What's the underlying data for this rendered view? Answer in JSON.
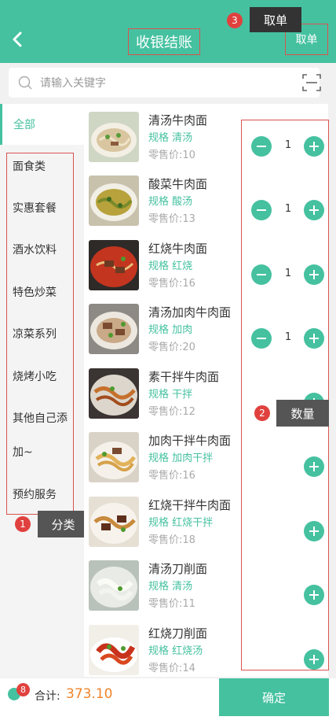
{
  "header": {
    "title": "收银结账",
    "take_order": "取单",
    "tip_take_order": "取单",
    "tip3_num": "3"
  },
  "search": {
    "placeholder": "请输入关键字"
  },
  "sidebar": {
    "selected": "全部",
    "items": [
      {
        "label": "面食类"
      },
      {
        "label": "实惠套餐"
      },
      {
        "label": "酒水饮料"
      },
      {
        "label": "特色炒菜"
      },
      {
        "label": "凉菜系列"
      },
      {
        "label": "烧烤小吃"
      },
      {
        "label": "其他自己添"
      },
      {
        "label": "加~"
      },
      {
        "label": "预约服务"
      }
    ],
    "tip_label": "分类",
    "tip_num": "1"
  },
  "quantity_tip": {
    "label": "数量",
    "num": "2"
  },
  "dishes": [
    {
      "name": "清汤牛肉面",
      "spec": "规格 清汤",
      "price": "零售价:10",
      "qty": "1"
    },
    {
      "name": "酸菜牛肉面",
      "spec": "规格 酸汤",
      "price": "零售价:13",
      "qty": "1"
    },
    {
      "name": "红烧牛肉面",
      "spec": "规格 红烧",
      "price": "零售价:16",
      "qty": "1"
    },
    {
      "name": "清汤加肉牛肉面",
      "spec": "规格 加肉",
      "price": "零售价:20",
      "qty": "1"
    },
    {
      "name": "素干拌牛肉面",
      "spec": "规格 干拌",
      "price": "零售价:12",
      "qty": ""
    },
    {
      "name": "加肉干拌牛肉面",
      "spec": "规格 加肉干拌",
      "price": "零售价:16",
      "qty": ""
    },
    {
      "name": "红烧干拌牛肉面",
      "spec": "规格 红烧干拌",
      "price": "零售价:18",
      "qty": ""
    },
    {
      "name": "清汤刀削面",
      "spec": "规格 清汤",
      "price": "零售价:11",
      "qty": ""
    },
    {
      "name": "红烧刀削面",
      "spec": "规格 红烧汤",
      "price": "零售价:14",
      "qty": ""
    }
  ],
  "footer": {
    "cart_count": "8",
    "total_label": "合计:",
    "total_value": "373.10",
    "confirm": "确定"
  },
  "colors": {
    "accent": "#45c1a0",
    "price": "#f0842c",
    "annotation": "#d9534f"
  }
}
